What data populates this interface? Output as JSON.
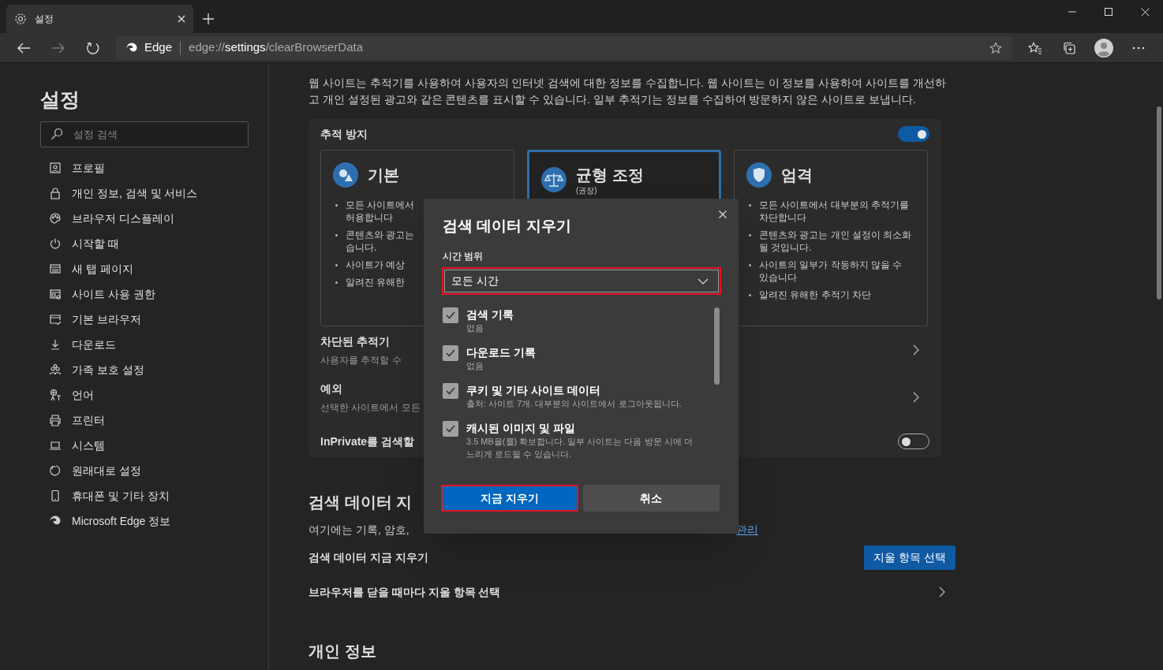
{
  "browser": {
    "tab": {
      "title": "설정"
    },
    "address_bar": {
      "site_label": "Edge",
      "url_scheme": "edge://",
      "url_host": "settings",
      "url_path": "/clearBrowserData"
    }
  },
  "sidebar": {
    "title": "설정",
    "search": {
      "placeholder": "설정 검색"
    },
    "items": [
      {
        "label": "프로필",
        "kind": "profile"
      },
      {
        "label": "개인 정보, 검색 및 서비스",
        "kind": "lock"
      },
      {
        "label": "브라우저 디스플레이",
        "kind": "palette"
      },
      {
        "label": "시작할 때",
        "kind": "power"
      },
      {
        "label": "새 탭 페이지",
        "kind": "newtab"
      },
      {
        "label": "사이트 사용 권한",
        "kind": "permissions"
      },
      {
        "label": "기본 브라우저",
        "kind": "browser"
      },
      {
        "label": "다운로드",
        "kind": "download"
      },
      {
        "label": "가족 보호 설정",
        "kind": "family"
      },
      {
        "label": "언어",
        "kind": "language"
      },
      {
        "label": "프린터",
        "kind": "printer"
      },
      {
        "label": "시스템",
        "kind": "system"
      },
      {
        "label": "원래대로 설정",
        "kind": "reset"
      },
      {
        "label": "휴대폰 및 기타 장치",
        "kind": "phone"
      },
      {
        "label": "Microsoft Edge 정보",
        "kind": "edge"
      }
    ]
  },
  "content": {
    "intro": "웹 사이트는 추적기를 사용하여 사용자의 인터넷 검색에 대한 정보를 수집합니다. 웹 사이트는 이 정보를 사용하여 사이트를 개선하고 개인 설정된 광고와 같은 콘텐츠를 표시할 수 있습니다. 일부 추적기는 정보를 수집하여 방문하지 않은 사이트로 보냅니다.",
    "tracking": {
      "title": "추적 방지",
      "on": true,
      "levels": [
        {
          "kind": "basic",
          "title": "기본",
          "selected": false,
          "bullets": [
            [
              "모든 사이트에서",
              "허용합니다"
            ],
            [
              "콘텐츠와 광고는",
              "습니다."
            ],
            [
              "사이트가 예상"
            ],
            [
              "알려진 유해한"
            ]
          ]
        },
        {
          "kind": "balanced",
          "title": "균형 조정",
          "subtitle": "(권장)",
          "selected": true
        },
        {
          "kind": "strict",
          "title": "엄격",
          "selected": false,
          "bullets": [
            [
              "모든 사이트에서 대부분의 추적기를",
              "차단합니다"
            ],
            [
              "콘텐츠와 광고는 개인 설정이 최소화",
              "될 것입니다."
            ],
            [
              "사이트의 일부가 작동하지 않을 수",
              "있습니다"
            ],
            [
              "알려진 유해한 추적기 차단"
            ]
          ]
        }
      ],
      "rows": [
        {
          "kind": "link",
          "title": "차단된 추적기",
          "description": "사용자를 추적할 수"
        },
        {
          "kind": "link",
          "title": "예외",
          "description": "선택한 사이트에서 모든"
        },
        {
          "kind": "toggle",
          "title": "InPrivate를 검색할",
          "on": false
        }
      ]
    },
    "clear_section": {
      "heading": "검색 데이터 지",
      "description": "여기에는 기록, 암호,",
      "link": "관리",
      "rows": [
        {
          "kind": "button",
          "title": "검색 데이터 지금 지우기",
          "button": "지울 항목 선택"
        },
        {
          "kind": "link",
          "title": "브라우저를 닫을 때마다 지울 항목 선택"
        }
      ]
    },
    "privacy_heading": "개인 정보"
  },
  "dialog": {
    "title": "검색 데이터 지우기",
    "range_label": "시간 범위",
    "range": {
      "value": "모든 시간",
      "highlighted": true
    },
    "options": [
      {
        "label": "검색 기록",
        "detail": "없음",
        "checked": true
      },
      {
        "label": "다운로드 기록",
        "detail": "없음",
        "checked": true
      },
      {
        "label": "쿠키 및 기타 사이트 데이터",
        "detail": "출처: 사이트 7개. 대부분의 사이트에서 로그아웃됩니다.",
        "checked": true
      },
      {
        "label": "캐시된 이미지 및 파일",
        "detail": "3.5 MB을(를) 확보합니다. 일부 사이트는 다음 방문 시에 더 느리게 로드될 수 있습니다.",
        "checked": true
      }
    ],
    "buttons": [
      {
        "kind": "primary",
        "label": "지금 지우기",
        "highlighted": true
      },
      {
        "kind": "secondary",
        "label": "취소",
        "highlighted": false
      }
    ]
  }
}
